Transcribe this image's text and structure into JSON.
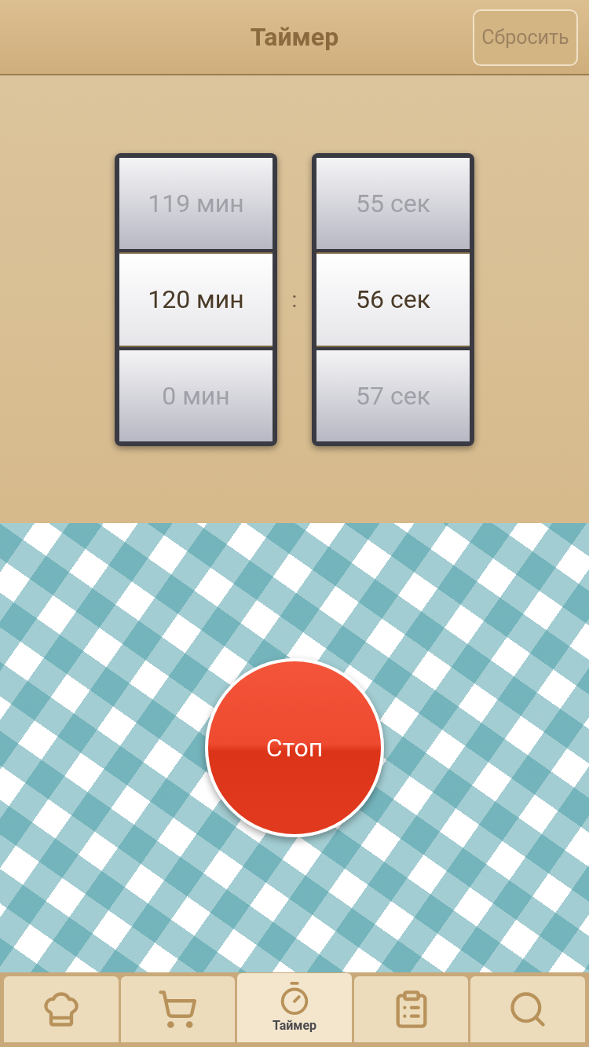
{
  "header": {
    "title": "Таймер",
    "reset_button": "Сбросить"
  },
  "pickers": [
    {
      "rows": [
        {
          "text": "119 мин",
          "selected": false
        },
        {
          "text": "120 мин",
          "selected": true
        },
        {
          "text": "0 мин",
          "selected": false
        }
      ]
    },
    {
      "rows": [
        {
          "text": "55 сек",
          "selected": false
        },
        {
          "text": "56 сек",
          "selected": true
        },
        {
          "text": "57 сек",
          "selected": false
        }
      ]
    }
  ],
  "separator": ":",
  "stop_button": "Стоп",
  "tabs": [
    {
      "kind": "chef",
      "selected": false
    },
    {
      "kind": "cart",
      "selected": false
    },
    {
      "kind": "timer",
      "selected": true,
      "label": "Таймер"
    },
    {
      "kind": "list",
      "selected": false
    },
    {
      "kind": "search",
      "selected": false
    }
  ]
}
